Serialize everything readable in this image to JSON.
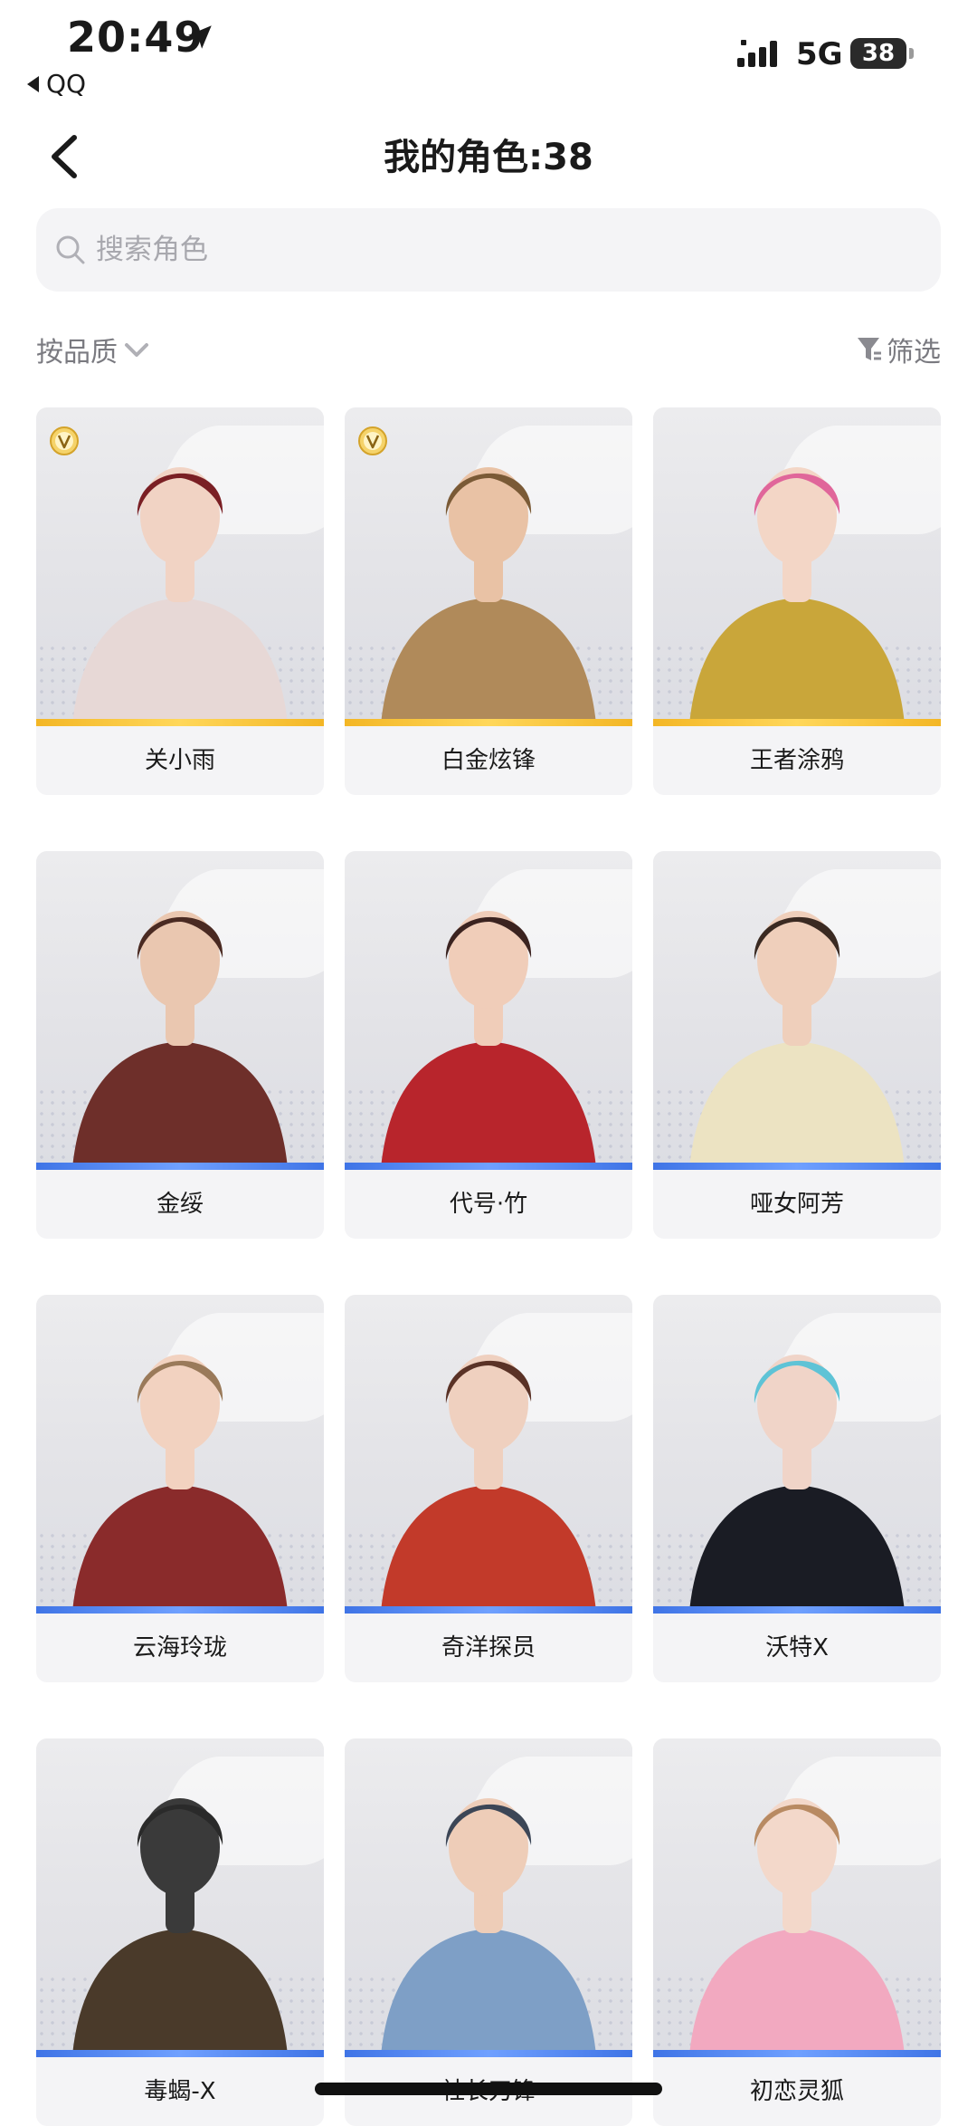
{
  "status_bar": {
    "time": "20:49",
    "back_app": "QQ",
    "network": "5G",
    "battery": "38"
  },
  "header": {
    "title": "我的角色:38"
  },
  "search": {
    "placeholder": "搜索角色",
    "value": ""
  },
  "toolbar": {
    "sort_label": "按品质",
    "filter_label": "筛选"
  },
  "colors": {
    "gold_quality": "#f3b625",
    "blue_quality": "#3f74e6"
  },
  "characters": [
    {
      "name": "关小雨",
      "quality": "gold",
      "vip": true
    },
    {
      "name": "白金炫锋",
      "quality": "gold",
      "vip": true
    },
    {
      "name": "王者涂鸦",
      "quality": "gold",
      "vip": false
    },
    {
      "name": "金绥",
      "quality": "blue",
      "vip": false
    },
    {
      "name": "代号·竹",
      "quality": "blue",
      "vip": false
    },
    {
      "name": "哑女阿芳",
      "quality": "blue",
      "vip": false
    },
    {
      "name": "云海玲珑",
      "quality": "blue",
      "vip": false
    },
    {
      "name": "奇洋探员",
      "quality": "blue",
      "vip": false
    },
    {
      "name": "沃特X",
      "quality": "blue",
      "vip": false
    },
    {
      "name": "毒蝎-X",
      "quality": "blue",
      "vip": false
    },
    {
      "name": "社长刀锋",
      "quality": "blue",
      "vip": false
    },
    {
      "name": "初恋灵狐",
      "quality": "blue",
      "vip": false
    }
  ]
}
